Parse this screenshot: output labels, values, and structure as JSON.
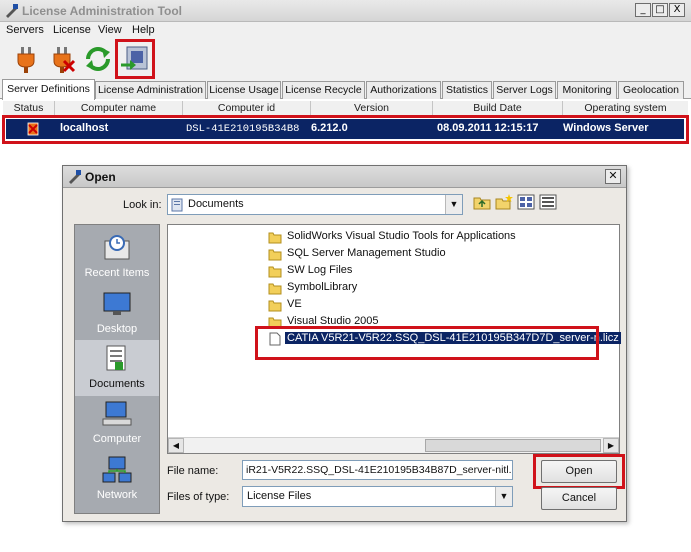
{
  "window": {
    "title": "License Administration Tool",
    "controls": [
      "_",
      "□",
      "X"
    ]
  },
  "menu": [
    "Servers",
    "License",
    "View",
    "Help"
  ],
  "toolbar": {
    "buttons": [
      "plug-connect-icon",
      "plug-disconnect-icon",
      "refresh-icon",
      "import-license-icon"
    ]
  },
  "tabs": [
    "Server Definitions",
    "License Administration",
    "License Usage",
    "License Recycle",
    "Authorizations",
    "Statistics",
    "Server Logs",
    "Monitoring",
    "Geolocation"
  ],
  "grid": {
    "columns": [
      "Status",
      "Computer name",
      "Computer id",
      "Version",
      "Build Date",
      "Operating system"
    ],
    "rows": [
      {
        "status_icon": "server-status-icon",
        "computer_name": "localhost",
        "computer_id": "DSL-41E210195B34B8",
        "version": "6.212.0",
        "build_date": "08.09.2011 12:15:17",
        "os": "Windows Server"
      }
    ]
  },
  "dialog": {
    "title": "Open",
    "look_in_label": "Look in:",
    "look_in_value": "Documents",
    "places": [
      "Recent Items",
      "Desktop",
      "Documents",
      "Computer",
      "Network"
    ],
    "active_place": "Documents",
    "files": [
      {
        "name": "SolidWorks Visual Studio Tools for Applications",
        "type": "folder"
      },
      {
        "name": "SQL Server Management Studio",
        "type": "folder"
      },
      {
        "name": "SW Log Files",
        "type": "folder"
      },
      {
        "name": "SymbolLibrary",
        "type": "folder"
      },
      {
        "name": "VE",
        "type": "folder"
      },
      {
        "name": "Visual Studio 2005",
        "type": "folder"
      },
      {
        "name": "CATIA V5R21-V5R22.SSQ_DSL-41E210195B347D7D_server-n.licz",
        "type": "file"
      }
    ],
    "selected_file_index": 6,
    "file_name_label": "File name:",
    "file_name_value": "iR21-V5R22.SSQ_DSL-41E210195B34B87D_server-nitl.licz",
    "files_of_type_label": "Files of type:",
    "files_of_type_value": "License Files",
    "open_button": "Open",
    "cancel_button": "Cancel"
  },
  "colors": {
    "highlight_box": "#d0121a",
    "selection": "#0b2464"
  }
}
